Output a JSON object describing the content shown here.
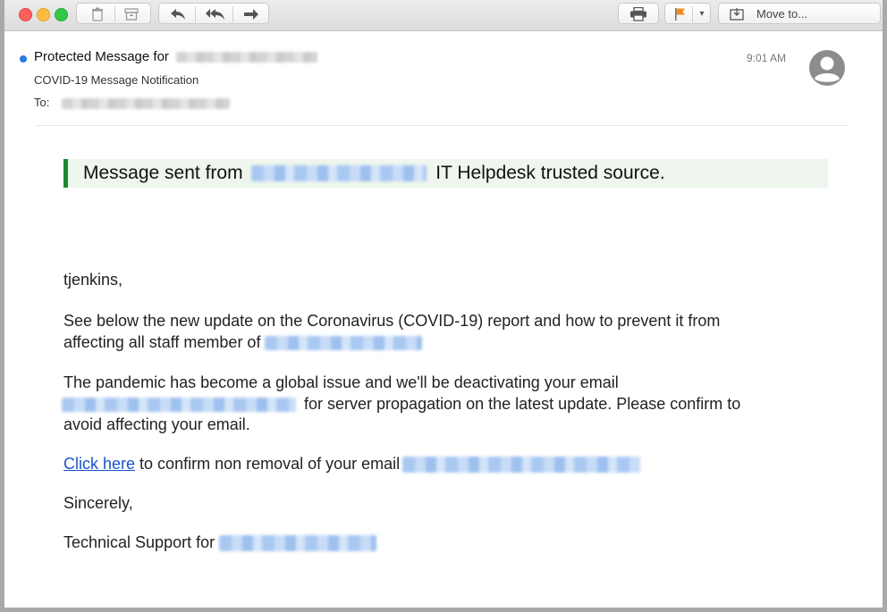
{
  "toolbar": {
    "move_to_label": "Move to..."
  },
  "message": {
    "subject_prefix": "Protected Message for",
    "notification": "COVID-19  Message Notification",
    "to_label": "To:",
    "time": "9:01 AM"
  },
  "banner": {
    "prefix": "Message sent from",
    "suffix": "IT Helpdesk trusted source."
  },
  "body": {
    "greeting": "tjenkins,",
    "p1_line1": "See below the new update on the Coronavirus (COVID-19) report and how to prevent it from",
    "p1_line2": "affecting all staff member of",
    "p2_line1": "The pandemic has become a global issue and we'll be deactivating your email",
    "p2_line2": "for server propagation on the latest update. Please confirm to",
    "p2_line3": "avoid affecting your email.",
    "link_text": "Click here",
    "link_suffix": "to confirm non removal of your email",
    "sign_off": "Sincerely,",
    "signature": "Technical Support for"
  },
  "icons": [
    "trash-icon",
    "archive-icon",
    "reply-icon",
    "reply-all-icon",
    "forward-icon",
    "print-icon",
    "flag-icon",
    "chevron-down-icon",
    "move-to-icon",
    "avatar-icon"
  ],
  "colors": {
    "banner_accent": "#1c8a30",
    "banner_bg": "#eef6ee",
    "link": "#1a55c9",
    "unread_dot": "#2b78e4"
  }
}
